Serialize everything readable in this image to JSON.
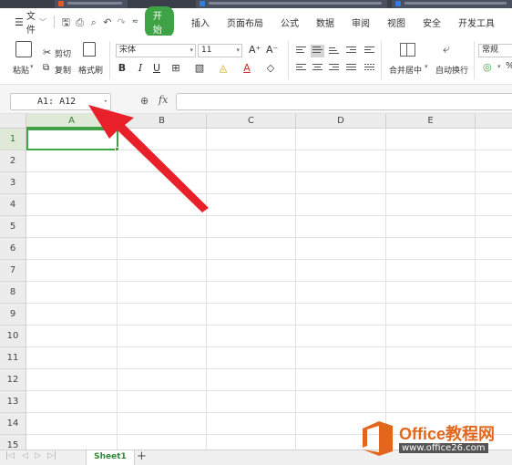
{
  "menubar": {
    "file_label": "文件",
    "start_label": "开始",
    "tabs": [
      "插入",
      "页面布局",
      "公式",
      "数据",
      "审阅",
      "视图",
      "安全",
      "开发工具"
    ]
  },
  "ribbon": {
    "paste_label": "粘贴",
    "cut_label": "剪切",
    "copy_label": "复制",
    "format_painter_label": "格式刷",
    "font_name": "宋体",
    "font_size": "11",
    "bold_label": "B",
    "italic_label": "I",
    "underline_label": "U",
    "merge_center_label": "合并居中",
    "wrap_text_label": "自动换行",
    "number_format": "常规"
  },
  "formula_bar": {
    "name_box_value": "A1: A12",
    "fx_label": "fx",
    "formula_value": ""
  },
  "grid": {
    "columns": [
      "A",
      "B",
      "C",
      "D",
      "E"
    ],
    "rows": [
      "1",
      "2",
      "3",
      "4",
      "5",
      "6",
      "7",
      "8",
      "9",
      "10",
      "11",
      "12",
      "13",
      "14",
      "15"
    ],
    "active_cell": "A1"
  },
  "sheets": {
    "tabs": [
      "Sheet1"
    ],
    "add_label": "+"
  },
  "watermark": {
    "title": "Office教程网",
    "url": "www.office26.com"
  },
  "colors": {
    "accent_green": "#3ea345",
    "annotation_red": "#e8202a",
    "watermark_orange": "#e2661b"
  }
}
